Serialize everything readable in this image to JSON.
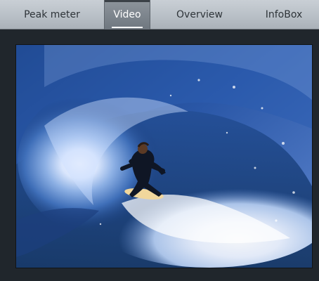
{
  "tabs": [
    {
      "label": "Peak meter",
      "active": false
    },
    {
      "label": "Video",
      "active": true
    },
    {
      "label": "Overview",
      "active": false
    },
    {
      "label": "InfoBox",
      "active": false
    }
  ],
  "video": {
    "content": "surfer-in-wave-barrel",
    "colors": {
      "deep_water": "#183a7a",
      "foam": "#e8f0ff",
      "panel_bg": "#20262c"
    }
  }
}
